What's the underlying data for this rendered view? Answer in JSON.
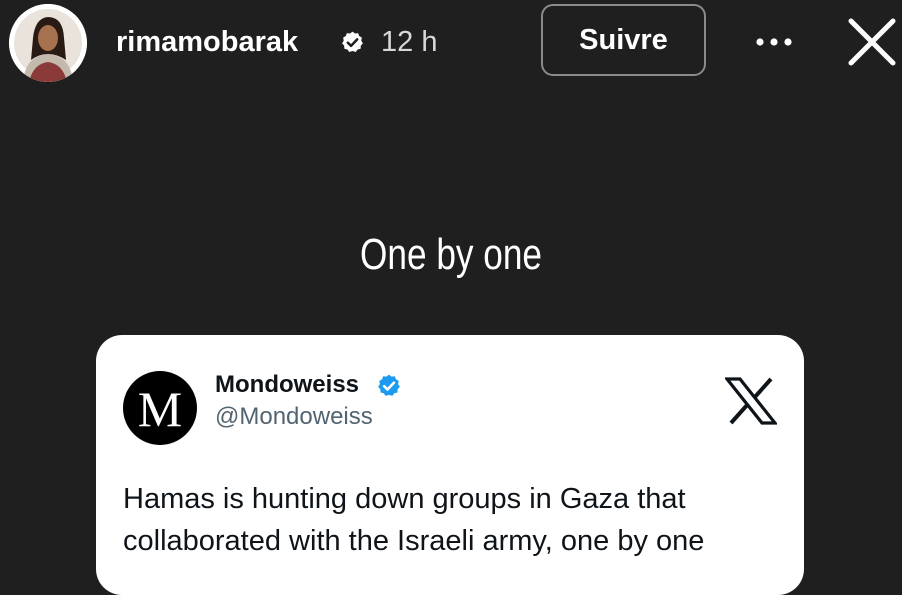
{
  "story": {
    "username": "rimamobarak",
    "time": "12 h",
    "follow_label": "Suivre",
    "more_label": "···",
    "caption": "One by one"
  },
  "tweet": {
    "avatar_letter": "M",
    "display_name": "Mondoweiss",
    "handle": "@Mondoweiss",
    "text": "Hamas is hunting down groups in Gaza that collaborated with the Israeli army, one by one"
  },
  "colors": {
    "background": "#1f1f1f",
    "verified_blue": "#1d9bf0",
    "card": "#ffffff"
  },
  "icons": {
    "verified_badge": "verified-icon",
    "more": "more-icon",
    "close": "close-icon",
    "x_logo": "x-logo-icon"
  }
}
